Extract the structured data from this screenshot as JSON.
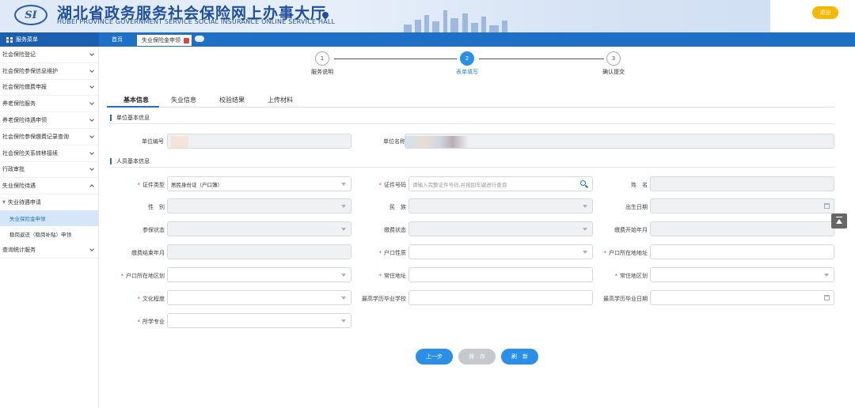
{
  "header": {
    "logo_text": "SI",
    "title_cn": "湖北省政务服务社会保险网上办事大厅",
    "title_en": "HUBEI PROVINCE GOVERNMENT SERVICE SOCIAL INSURANCE ONLINE SERVICE HALL",
    "logout_label": "退出"
  },
  "navbar": {
    "menu_label": "服务菜单",
    "home_tab": "首页",
    "active_tab": "失业保险金申领"
  },
  "sidebar": {
    "items": [
      {
        "label": "社会保险登记"
      },
      {
        "label": "社会保险参保信息维护"
      },
      {
        "label": "社会保险缴费申报"
      },
      {
        "label": "养老保险服务"
      },
      {
        "label": "养老保险待遇申领"
      },
      {
        "label": "社会保险参保缴费记录查询"
      },
      {
        "label": "社会保险关系转移接续"
      },
      {
        "label": "行政审批"
      },
      {
        "label": "失业保险待遇"
      }
    ],
    "sub_group": "失业待遇申请",
    "leaves": [
      "失业保险金申领",
      "稳岗返还（稳岗补贴）申领"
    ],
    "last_item": "查询统计服务"
  },
  "steps": [
    {
      "num": "1",
      "label": "服务说明"
    },
    {
      "num": "2",
      "label": "表单填写"
    },
    {
      "num": "3",
      "label": "确认提交"
    }
  ],
  "tabs": [
    "基本信息",
    "失业信息",
    "校验结果",
    "上传材料"
  ],
  "sections": {
    "unit": "单位基本信息",
    "person": "人员基本信息"
  },
  "unit_fields": {
    "unit_no_label": "单位编号",
    "unit_name_label": "单位名称"
  },
  "person_fields": {
    "id_type_label": "证件类型",
    "id_type_value": "居民身份证（户口簿）",
    "id_no_label": "证件号码",
    "id_no_placeholder": "请输入完整证件号码,并按回车键进行查询",
    "name_label": "姓　名",
    "gender_label": "性　别",
    "ethnicity_label": "民　族",
    "birth_label": "出生日期",
    "insured_status_label": "参保状态",
    "pay_status_label": "缴费状态",
    "pay_start_label": "缴费开始年月",
    "pay_end_label": "缴费结束年月",
    "hukou_nature_label": "户口性质",
    "hukou_addr_label": "户口所在地地址",
    "hukou_region_label": "户口所在地区划",
    "residence_addr_label": "常住地址",
    "residence_region_label": "常住地区划",
    "education_label": "文化程度",
    "school_label": "最高学历毕业学校",
    "grad_date_label": "最高学历毕业日期",
    "major_label": "所学专业"
  },
  "buttons": {
    "prev": "上一步",
    "save": "保　存",
    "refresh": "刷　新"
  },
  "colors": {
    "brand_blue": "#1e6fc6",
    "accent_blue": "#2a8fe8",
    "logout_yellow": "#f5b800",
    "required_red": "#e0424e"
  }
}
